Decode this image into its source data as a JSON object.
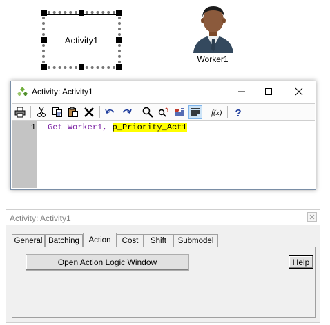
{
  "canvas": {
    "activity_label": "Activity1",
    "worker_label": "Worker1"
  },
  "editor": {
    "title": "Activity: Activity1",
    "toolbar": [
      "print-icon",
      "cut-icon",
      "copy-icon",
      "paste-icon",
      "delete-icon",
      "undo-icon",
      "redo-icon",
      "find-icon",
      "replace-icon",
      "toggle-bookmark-icon",
      "format-icon",
      "function-icon",
      "help-icon"
    ],
    "line_number": "1",
    "code": {
      "keyword": "Get",
      "resource": "Worker1,",
      "highlighted": "p_Priority_Act1"
    }
  },
  "dialog": {
    "title": "Activity: Activity1",
    "tabs": [
      "General",
      "Batching",
      "Action",
      "Cost",
      "Shift",
      "Submodel"
    ],
    "active_tab": "Action",
    "open_logic_button": "Open Action Logic Window",
    "help_button": "Help"
  },
  "colors": {
    "keyword": "#7a1fa2",
    "highlight": "#ffff00",
    "help_icon": "#1e3c9c"
  }
}
